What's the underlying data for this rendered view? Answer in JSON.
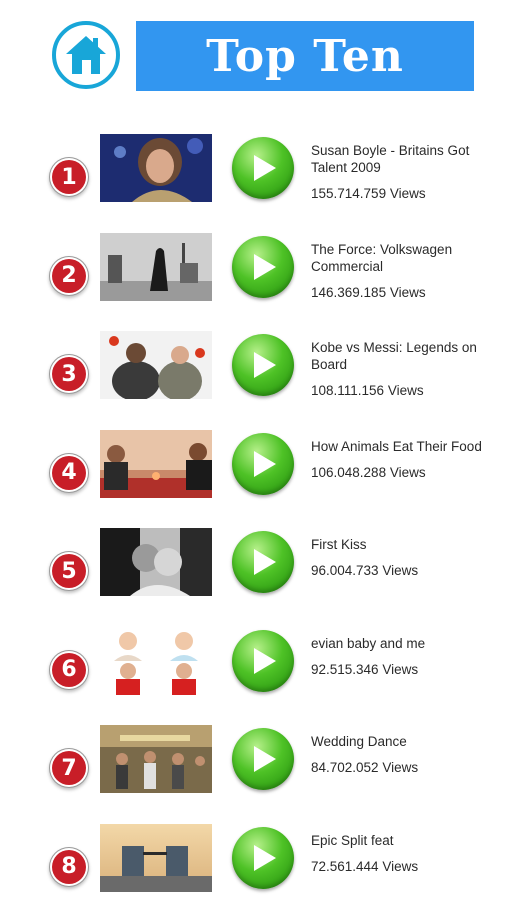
{
  "header": {
    "title": "Top Ten",
    "home_icon": "house-icon",
    "colors": {
      "title_bar": "#3296f0",
      "home_ring": "#18a6d8",
      "rank_badge": "#c81e28",
      "play_green": "#4ec226"
    }
  },
  "videos": [
    {
      "rank": "1",
      "title": "Susan Boyle - Britains Got Talent 2009",
      "views": "155.714.759 Views"
    },
    {
      "rank": "2",
      "title": "The Force: Volkswagen Commercial",
      "views": "146.369.185 Views"
    },
    {
      "rank": "3",
      "title": "Kobe vs Messi: Legends on Board",
      "views": "108.111.156 Views"
    },
    {
      "rank": "4",
      "title": "How Animals Eat Their Food",
      "views": "106.048.288 Views"
    },
    {
      "rank": "5",
      "title": "First Kiss",
      "views": "96.004.733 Views"
    },
    {
      "rank": "6",
      "title": "evian baby and me",
      "views": "92.515.346 Views"
    },
    {
      "rank": "7",
      "title": "Wedding Dance",
      "views": "84.702.052 Views"
    },
    {
      "rank": "8",
      "title": "Epic Split feat",
      "views": "72.561.444 Views"
    }
  ]
}
